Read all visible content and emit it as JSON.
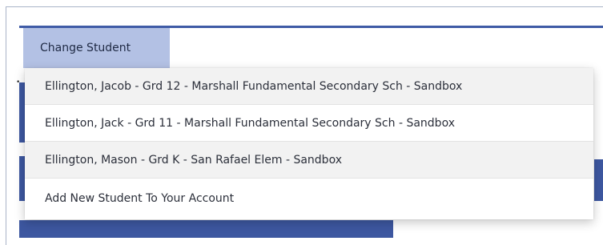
{
  "tab": {
    "label": "Change Student"
  },
  "dropdown": {
    "items": [
      {
        "label": "Ellington, Jacob - Grd 12 - Marshall Fundamental Secondary Sch - Sandbox"
      },
      {
        "label": "Ellington, Jack - Grd 11 - Marshall Fundamental Secondary Sch - Sandbox"
      },
      {
        "label": "Ellington, Mason - Grd K - San Rafael Elem - Sandbox"
      },
      {
        "label": "Add New Student To Your Account"
      }
    ]
  },
  "colors": {
    "accent": "#3d57a0",
    "tab_bg": "#b3c1e4",
    "item_alt_bg": "#f2f2f2"
  }
}
